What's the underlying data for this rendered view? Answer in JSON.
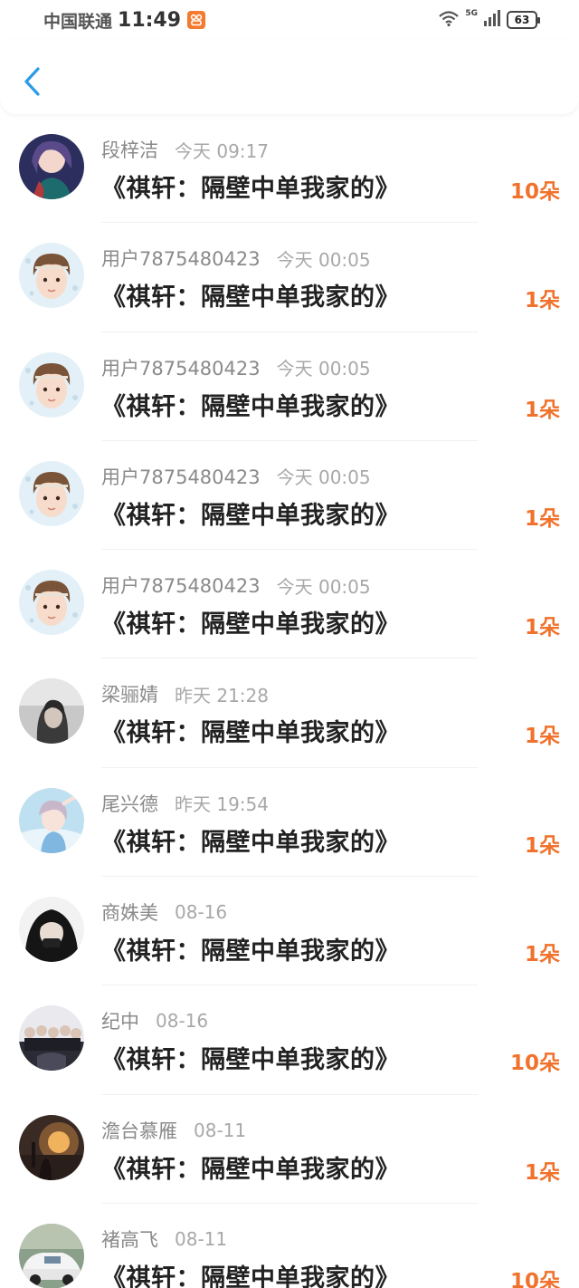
{
  "status_bar": {
    "carrier": "中国联通",
    "time": "11:49",
    "network": "5G",
    "battery": "63",
    "accent": "#f37a2e"
  },
  "nav": {
    "back_icon": "chevron-left-icon",
    "accent": "#2b9be8"
  },
  "colors": {
    "amount": "#f0722c",
    "name": "#8a8a8a",
    "title": "#222222"
  },
  "items": [
    {
      "name": "段梓洁",
      "time": "今天 09:17",
      "title": "《祺轩：隔壁中单我家的》",
      "amount": "10朵",
      "avatar": "anime-girl-avatar"
    },
    {
      "name": "用户7875480423",
      "time": "今天 00:05",
      "title": "《祺轩：隔壁中单我家的》",
      "amount": "1朵",
      "avatar": "anime-boy-avatar"
    },
    {
      "name": "用户7875480423",
      "time": "今天 00:05",
      "title": "《祺轩：隔壁中单我家的》",
      "amount": "1朵",
      "avatar": "anime-boy-avatar"
    },
    {
      "name": "用户7875480423",
      "time": "今天 00:05",
      "title": "《祺轩：隔壁中单我家的》",
      "amount": "1朵",
      "avatar": "anime-boy-avatar"
    },
    {
      "name": "用户7875480423",
      "time": "今天 00:05",
      "title": "《祺轩：隔壁中单我家的》",
      "amount": "1朵",
      "avatar": "anime-boy-avatar"
    },
    {
      "name": "梁骊婧",
      "time": "昨天 21:28",
      "title": "《祺轩：隔壁中单我家的》",
      "amount": "1朵",
      "avatar": "gray-photo-avatar"
    },
    {
      "name": "尾兴德",
      "time": "昨天 19:54",
      "title": "《祺轩：隔壁中单我家的》",
      "amount": "1朵",
      "avatar": "anime-blue-avatar"
    },
    {
      "name": "商姝美",
      "time": "08-16",
      "title": "《祺轩：隔壁中单我家的》",
      "amount": "1朵",
      "avatar": "dark-hoodie-avatar"
    },
    {
      "name": "纪中",
      "time": "08-16",
      "title": "《祺轩：隔壁中单我家的》",
      "amount": "10朵",
      "avatar": "group-photo-avatar"
    },
    {
      "name": "澹台慕雁",
      "time": "08-11",
      "title": "《祺轩：隔壁中单我家的》",
      "amount": "1朵",
      "avatar": "sunset-avatar"
    },
    {
      "name": "褚高飞",
      "time": "08-11",
      "title": "《祺轩：隔壁中单我家的》",
      "amount": "10朵",
      "avatar": "car-avatar"
    }
  ]
}
